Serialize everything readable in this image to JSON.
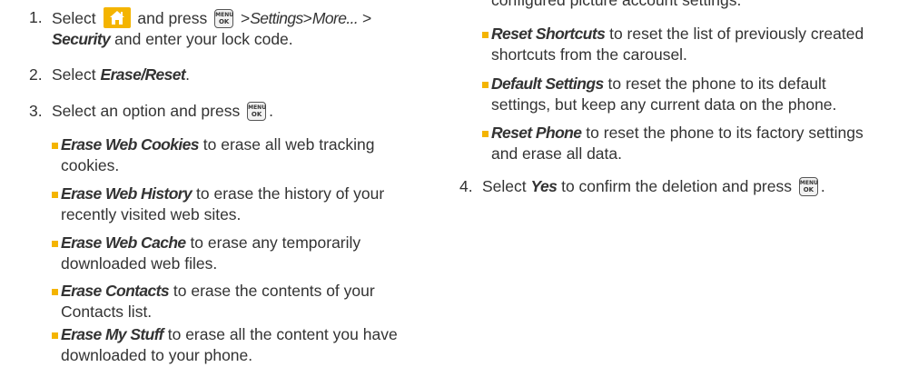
{
  "left": {
    "step1": {
      "num": "1.",
      "select": "Select",
      "and_press": "and press",
      "gt1": ">",
      "settings": "Settings",
      "gt2": ">",
      "more": "More...",
      "gt3": ">",
      "security": "Security",
      "rest": "and enter your lock code."
    },
    "step2": {
      "num": "2.",
      "select": "Select",
      "erase_reset": "Erase/Reset",
      "period": "."
    },
    "step3": {
      "num": "3.",
      "text": "Select an option and press",
      "period": "."
    },
    "bullets": [
      {
        "term": "Erase Web Cookies",
        "desc": "to erase all web tracking cookies."
      },
      {
        "term": "Erase Web History",
        "desc": "to erase the history of your recently visited web sites."
      },
      {
        "term": "Erase Web Cache",
        "desc": "to erase any temporarily downloaded web files."
      },
      {
        "term": "Erase Contacts",
        "desc": "to erase the contents of your Contacts list."
      },
      {
        "term": "Erase My Stuff",
        "desc": "to erase all the content you have downloaded to your phone."
      }
    ]
  },
  "right": {
    "partial_top": "configured picture account settings.",
    "bullets": [
      {
        "term": "Reset Shortcuts",
        "desc": "to reset the list of previously created shortcuts from the carousel."
      },
      {
        "term": "Default Settings",
        "desc": "to reset the phone to its default settings, but keep any current data on the phone."
      },
      {
        "term": "Reset Phone",
        "desc": "to reset the phone to its factory settings and erase all data."
      }
    ],
    "step4": {
      "num": "4.",
      "select": "Select",
      "yes": "Yes",
      "rest": "to confirm the deletion and press",
      "period": "."
    }
  },
  "keys": {
    "menu_top": "MENU",
    "menu_bottom": "OK"
  },
  "icons": {
    "home": "home-icon",
    "menu_ok": "menu-ok-key-icon"
  },
  "colors": {
    "accent": "#f4b400",
    "text": "#333333"
  }
}
